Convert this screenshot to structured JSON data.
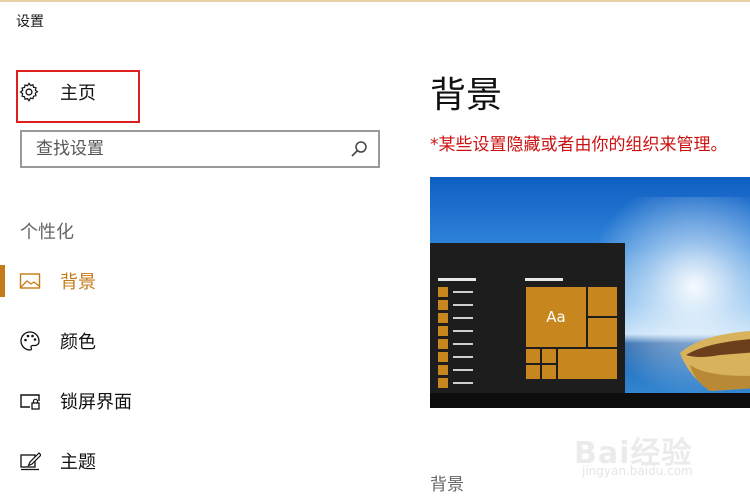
{
  "window": {
    "title": "设置"
  },
  "sidebar": {
    "home_label": "主页",
    "search_placeholder": "查找设置",
    "section_title": "个性化",
    "items": [
      {
        "label": "背景",
        "icon": "picture-icon",
        "active": true
      },
      {
        "label": "颜色",
        "icon": "palette-icon",
        "active": false
      },
      {
        "label": "锁屏界面",
        "icon": "lock-screen-icon",
        "active": false
      },
      {
        "label": "主题",
        "icon": "theme-brush-icon",
        "active": false
      }
    ]
  },
  "main": {
    "title": "背景",
    "managed_note": "*某些设置隐藏或者由你的组织来管理。",
    "preview_tile_text": "Aa",
    "section_background": "背景"
  },
  "watermark": {
    "brand": "Bai经验",
    "url": "jingyan.baidu.com"
  },
  "colors": {
    "accent": "#c47a16",
    "warning": "#cc1111",
    "highlight_box": "#e02020"
  }
}
